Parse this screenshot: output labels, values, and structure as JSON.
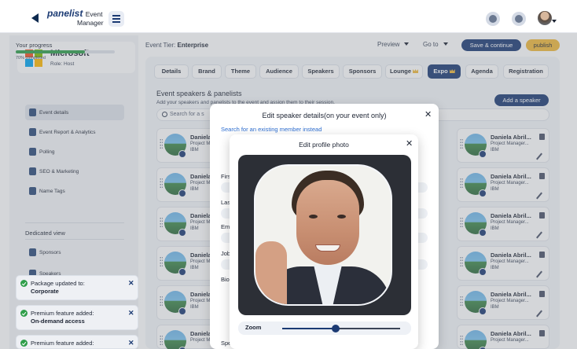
{
  "app": {
    "logo_brand": "panelist",
    "logo_line1": "Event",
    "logo_line2": "Manager"
  },
  "sidebar": {
    "org_name": "Microsoft",
    "org_role": "Role: Host",
    "progress_label": "Your progress",
    "progress_value": 0.7,
    "progress_text": "70% completed",
    "items": [
      {
        "label": "Event details",
        "active": true
      },
      {
        "label": "Event Report & Analytics"
      },
      {
        "label": "Polling"
      },
      {
        "label": "SEO & Marketing"
      },
      {
        "label": "Name Tags"
      }
    ],
    "dedicated_label": "Dedicated view",
    "dedicated_items": [
      {
        "label": "Sponsors"
      },
      {
        "label": "Speakers"
      }
    ]
  },
  "toasts": [
    {
      "line1": "Package updated to:",
      "line2": "Corporate"
    },
    {
      "line1": "Premium feature added:",
      "line2": "On-demand access"
    },
    {
      "line1": "Premium feature added:",
      "line2": ""
    }
  ],
  "header": {
    "tier_label": "Event Tier:",
    "tier_value": "Enterprise",
    "preview": "Preview",
    "goto": "Go to",
    "save": "Save & continue",
    "publish": "publish"
  },
  "tabs": [
    {
      "label": "Details"
    },
    {
      "label": "Brand"
    },
    {
      "label": "Theme"
    },
    {
      "label": "Audience"
    },
    {
      "label": "Speakers"
    },
    {
      "label": "Sponsors"
    },
    {
      "label": "Lounge",
      "premium": true
    },
    {
      "label": "Expo",
      "premium": true,
      "active": true
    },
    {
      "label": "Agenda"
    },
    {
      "label": "Registration"
    }
  ],
  "section": {
    "title": "Event speakers & panelists",
    "subtitle": "Add your speakers and panelists to the event and assign them to their session.",
    "add_button": "Add a speaker",
    "search_placeholder": "Search for a s"
  },
  "speaker_card": {
    "name_left": "Daniela",
    "role_left": "Project M",
    "company": "IBM",
    "name_right": "Daniela Abril...",
    "role_right": "Project Manager..."
  },
  "edit_modal": {
    "title": "Edit speaker details(on your event only)",
    "link": "Search for an existing member instead",
    "labels": [
      "Firs",
      "Las",
      "Em",
      "Job",
      "Bio",
      "Spe"
    ]
  },
  "photo_modal": {
    "title": "Edit profile photo",
    "zoom_label": "Zoom",
    "zoom_value": 0.45
  },
  "colors": {
    "primary": "#1b3a73",
    "accent": "#f0b93a",
    "success": "#2f9e4a",
    "link": "#2f6fd1"
  }
}
